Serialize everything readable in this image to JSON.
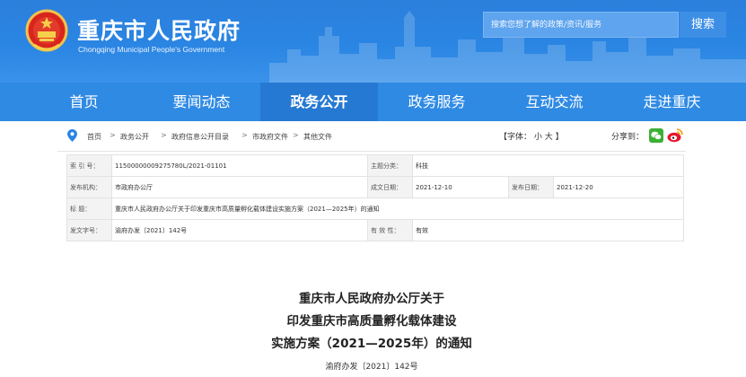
{
  "header": {
    "title": "重庆市人民政府",
    "subtitle": "Chongqing Municipal People's Government",
    "search_placeholder": "搜索您想了解的政策/资讯/服务",
    "search_button": "搜索"
  },
  "nav": {
    "items": [
      "首页",
      "要闻动态",
      "政务公开",
      "政务服务",
      "互动交流",
      "走进重庆"
    ],
    "active": "政务公开"
  },
  "breadcrumb": [
    "首页",
    "政务公开",
    "政府信息公开目录",
    "市政府文件",
    "其他文件"
  ],
  "font_size": {
    "label": "【字体：",
    "small": "小",
    "large": "大",
    "close": "】"
  },
  "share_label": "分享到：",
  "info": {
    "index_label": "索 引 号：",
    "index_value": "11500000009275780L/2021-01101",
    "theme_label": "主题分类：",
    "theme_value": "科技",
    "issuer_label": "发布机构：",
    "issuer_value": "市政府办公厅",
    "written_label": "成文日期：",
    "written_value": "2021-12-10",
    "published_label": "发布日期：",
    "published_value": "2021-12-20",
    "title_label": "标    题：",
    "title_value": "重庆市人民政府办公厅关于印发重庆市高质量孵化载体建设实施方案（2021—2025年）的通知",
    "docno_label": "发文字号：",
    "docno_value": "渝府办发〔2021〕142号",
    "valid_label": "有 效 性：",
    "valid_value": "有效"
  },
  "document": {
    "title_line1": "重庆市人民政府办公厅关于",
    "title_line2": "印发重庆市高质量孵化载体建设",
    "title_line3": "实施方案（2021—2025年）的通知",
    "number": "渝府办发〔2021〕142号"
  },
  "colors": {
    "header_blue": "#2a85e3",
    "nav_blue": "#2f8ae4",
    "nav_active": "#2679d2"
  }
}
